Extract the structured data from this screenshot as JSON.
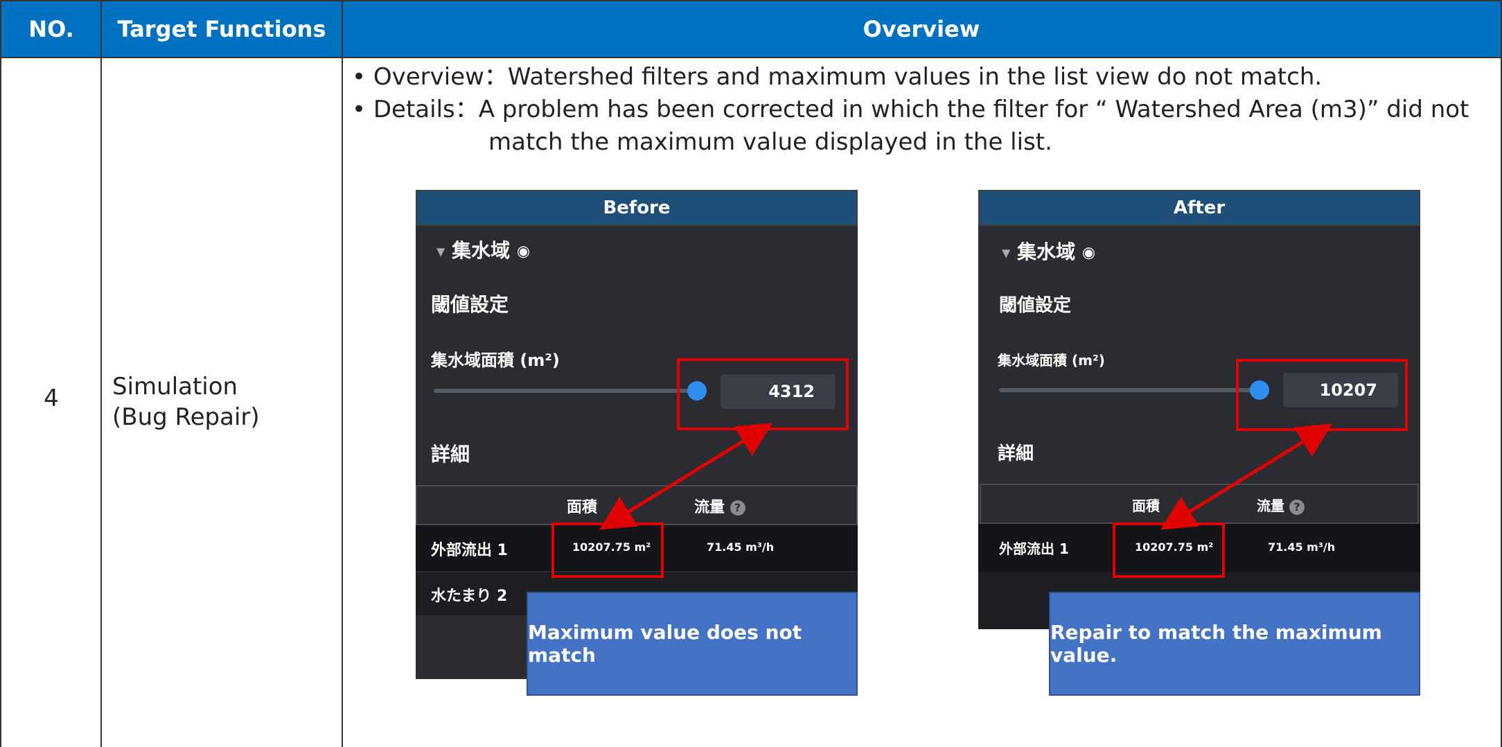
{
  "header": {
    "no_label": "NO.",
    "functions_label": "Target Functions",
    "overview_label": "Overview"
  },
  "row": {
    "no": "4",
    "function_line1": "Simulation",
    "function_line2": "(Bug Repair)",
    "overview_line": "• Overview：Watershed filters and maximum values in the list view do not match.",
    "details_line1": "• Details：A problem has been corrected in which the filter for “ Watershed Area (m3)” did not",
    "details_line2": "match the maximum value displayed in the list."
  },
  "before": {
    "title": "Before",
    "section": "集水域",
    "threshold": "閾値設定",
    "area_label": "集水域面積 (m²)",
    "slider_value": "4312",
    "slider_level": 1.0,
    "details": "詳細",
    "col_area": "面積",
    "col_flow": "流量",
    "row1_name": "外部流出 1",
    "row1_area": "10207.75 m²",
    "row1_flow": "71.45 m³/h",
    "row2_name": "水たまり 2",
    "callout": "Maximum value does not match"
  },
  "after": {
    "title": "After",
    "section": "集水域",
    "threshold": "閾値設定",
    "area_label": "集水域面積 (m²)",
    "slider_value": "10207",
    "slider_level": 1.0,
    "details": "詳細",
    "col_area": "面積",
    "col_flow": "流量",
    "row1_name": "外部流出 1",
    "row1_area": "10207.75 m²",
    "row1_flow": "71.45 m³/h",
    "callout": "Repair to match the maximum value."
  },
  "colors": {
    "header_blue": "#0070c0",
    "panel_title": "#1f4e79",
    "highlight_red": "#e00000",
    "callout_blue": "#4472c4"
  }
}
